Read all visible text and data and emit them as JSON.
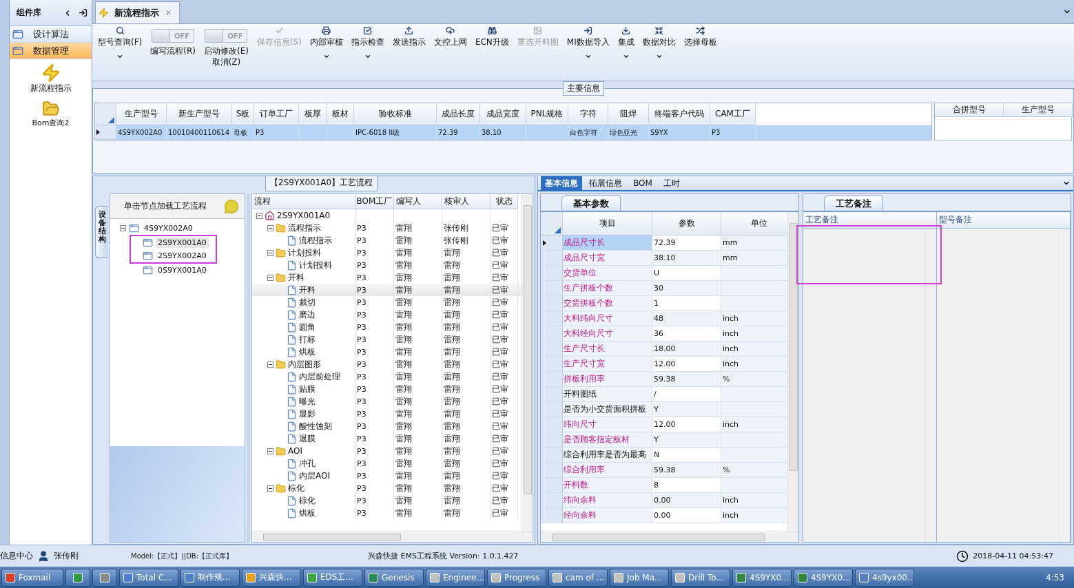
{
  "sidebar": {
    "title": "组件库",
    "items": [
      {
        "label": "设计算法",
        "selected": false
      },
      {
        "label": "数据管理",
        "selected": true
      }
    ],
    "shortcuts": [
      {
        "kind": "bolt",
        "label": "新流程指示"
      },
      {
        "kind": "folder",
        "label": "Bom查询2"
      }
    ]
  },
  "document_tab": {
    "label": "新流程指示",
    "selected": true
  },
  "toolbar": [
    {
      "kind": "button",
      "label": "型号查询(F)",
      "dropdown": true,
      "disabled": false
    },
    {
      "kind": "toggle",
      "switch_text": "OFF",
      "on": false,
      "label": "编写流程(R)"
    },
    {
      "kind": "toggle",
      "switch_text": "OFF",
      "on": false,
      "label": "启动修改(E)\n取消(Z)"
    },
    {
      "kind": "button",
      "label": "保存信息(S)",
      "dropdown": false,
      "disabled": true
    },
    {
      "kind": "button",
      "label": "内部审核",
      "dropdown": true,
      "disabled": false
    },
    {
      "kind": "button",
      "label": "指示检查",
      "dropdown": true,
      "disabled": false
    },
    {
      "kind": "button",
      "label": "发送指示",
      "dropdown": false,
      "disabled": false
    },
    {
      "kind": "button",
      "label": "文控上网",
      "dropdown": false,
      "disabled": false
    },
    {
      "kind": "button",
      "label": "ECN升级",
      "dropdown": false,
      "disabled": false
    },
    {
      "kind": "button",
      "label": "重选开料图",
      "dropdown": false,
      "disabled": true
    },
    {
      "kind": "button",
      "label": "MI数据导入",
      "dropdown": true,
      "disabled": false
    },
    {
      "kind": "button",
      "label": "集成",
      "dropdown": true,
      "disabled": false
    },
    {
      "kind": "button",
      "label": "数据对比",
      "dropdown": true,
      "disabled": false
    },
    {
      "kind": "button",
      "label": "选择母板",
      "dropdown": false,
      "disabled": false
    }
  ],
  "main_info": {
    "title": "主要信息",
    "columns": [
      "生产型号",
      "新生产型号",
      "S板",
      "订单工厂",
      "板厚",
      "板材",
      "验收标准",
      "成品长度",
      "成品宽度",
      "PNL规格",
      "字符",
      "阻焊",
      "终端客户代码",
      "CAM工厂"
    ],
    "rows": [
      {
        "selected": true,
        "cells": [
          "4S9YX002A0",
          "10010400110614",
          "母板",
          "P3",
          null,
          null,
          "IPC-6018 II级",
          "72.39",
          "38.10",
          null,
          "白色字符",
          "绿色亚光",
          "S9YX",
          "P3"
        ]
      }
    ],
    "merge_columns": [
      "合拼型号",
      "生产型号"
    ]
  },
  "flow": {
    "title": "【2S9YX001A0】工艺流程",
    "side_tab": "设备结构",
    "tree_hint": "单击节点加载工艺流程",
    "models": [
      {
        "label": "4S9YX002A0",
        "expanded": true,
        "selected": false,
        "children": [
          {
            "label": "2S9YX001A0",
            "selected": true
          },
          {
            "label": "2S9YX002A0",
            "selected": false
          },
          {
            "label": "0S9YX001A0",
            "selected": false
          }
        ]
      }
    ],
    "columns": [
      "流程",
      "BOM工厂",
      "编写人",
      "核审人",
      "状态"
    ],
    "root": {
      "kind": "root",
      "label": "2S9YX001A0",
      "expanded": true,
      "selected": false,
      "children": [
        {
          "kind": "folder",
          "label": "流程指示",
          "bom": "P3",
          "writer": "雷翔",
          "reviewer": "张传刚",
          "status": "已审",
          "expanded": true,
          "selected": false,
          "children": [
            {
              "kind": "step",
              "label": "流程指示",
              "bom": "P3",
              "writer": "雷翔",
              "reviewer": "张传刚",
              "status": "已审",
              "selected": false
            }
          ]
        },
        {
          "kind": "folder",
          "label": "计划投料",
          "bom": "P3",
          "writer": "雷翔",
          "reviewer": "雷翔",
          "status": "已审",
          "expanded": true,
          "selected": false,
          "children": [
            {
              "kind": "step",
              "label": "计划投料",
              "bom": "P3",
              "writer": "雷翔",
              "reviewer": "雷翔",
              "status": "已审",
              "selected": false
            }
          ]
        },
        {
          "kind": "folder",
          "label": "开料",
          "bom": "P3",
          "writer": "雷翔",
          "reviewer": "雷翔",
          "status": "已审",
          "expanded": true,
          "selected": false,
          "children": [
            {
              "kind": "step",
              "label": "开料",
              "bom": "P3",
              "writer": "雷翔",
              "reviewer": "雷翔",
              "status": "已审",
              "selected": true
            },
            {
              "kind": "step",
              "label": "裁切",
              "bom": "P3",
              "writer": "雷翔",
              "reviewer": "雷翔",
              "status": "已审",
              "selected": false
            },
            {
              "kind": "step",
              "label": "磨边",
              "bom": "P3",
              "writer": "雷翔",
              "reviewer": "雷翔",
              "status": "已审",
              "selected": false
            },
            {
              "kind": "step",
              "label": "圆角",
              "bom": "P3",
              "writer": "雷翔",
              "reviewer": "雷翔",
              "status": "已审",
              "selected": false
            },
            {
              "kind": "step",
              "label": "打标",
              "bom": "P3",
              "writer": "雷翔",
              "reviewer": "雷翔",
              "status": "已审",
              "selected": false
            },
            {
              "kind": "step",
              "label": "烘板",
              "bom": "P3",
              "writer": "雷翔",
              "reviewer": "雷翔",
              "status": "已审",
              "selected": false
            }
          ]
        },
        {
          "kind": "folder",
          "label": "内层图形",
          "bom": "P3",
          "writer": "雷翔",
          "reviewer": "雷翔",
          "status": "已审",
          "expanded": true,
          "selected": false,
          "children": [
            {
              "kind": "step",
              "label": "内层前处理",
              "bom": "P3",
              "writer": "雷翔",
              "reviewer": "雷翔",
              "status": "已审",
              "selected": false
            },
            {
              "kind": "step",
              "label": "贴膜",
              "bom": "P3",
              "writer": "雷翔",
              "reviewer": "雷翔",
              "status": "已审",
              "selected": false
            },
            {
              "kind": "step",
              "label": "曝光",
              "bom": "P3",
              "writer": "雷翔",
              "reviewer": "雷翔",
              "status": "已审",
              "selected": false
            },
            {
              "kind": "step",
              "label": "显影",
              "bom": "P3",
              "writer": "雷翔",
              "reviewer": "雷翔",
              "status": "已审",
              "selected": false
            },
            {
              "kind": "step",
              "label": "酸性蚀刻",
              "bom": "P3",
              "writer": "雷翔",
              "reviewer": "雷翔",
              "status": "已审",
              "selected": false
            },
            {
              "kind": "step",
              "label": "退膜",
              "bom": "P3",
              "writer": "雷翔",
              "reviewer": "雷翔",
              "status": "已审",
              "selected": false
            }
          ]
        },
        {
          "kind": "folder",
          "label": "AOI",
          "bom": "P3",
          "writer": "雷翔",
          "reviewer": "雷翔",
          "status": "已审",
          "expanded": true,
          "selected": false,
          "children": [
            {
              "kind": "step",
              "label": "冲孔",
              "bom": "P3",
              "writer": "雷翔",
              "reviewer": "雷翔",
              "status": "已审",
              "selected": false
            },
            {
              "kind": "step",
              "label": "内层AOI",
              "bom": "P3",
              "writer": "雷翔",
              "reviewer": "雷翔",
              "status": "已审",
              "selected": false
            }
          ]
        },
        {
          "kind": "folder",
          "label": "棕化",
          "bom": "P3",
          "writer": "雷翔",
          "reviewer": "雷翔",
          "status": "已审",
          "expanded": true,
          "selected": false,
          "children": [
            {
              "kind": "step",
              "label": "棕化",
              "bom": "P3",
              "writer": "雷翔",
              "reviewer": "雷翔",
              "status": "已审",
              "selected": false
            },
            {
              "kind": "step",
              "label": "烘板",
              "bom": "P3",
              "writer": "雷翔",
              "reviewer": "雷翔",
              "status": "已审",
              "selected": false
            }
          ]
        }
      ]
    }
  },
  "details": {
    "tabs": [
      {
        "label": "基本信息",
        "selected": true
      },
      {
        "label": "拓展信息",
        "selected": false
      },
      {
        "label": "BOM",
        "selected": false
      },
      {
        "label": "工时",
        "selected": false
      }
    ],
    "params": {
      "tab": "基本参数",
      "columns": [
        "项目",
        "参数",
        "单位"
      ],
      "rows": [
        {
          "item": "成品尺寸长",
          "value": "72.39",
          "unit": "mm",
          "required": true,
          "selected": true
        },
        {
          "item": "成品尺寸宽",
          "value": "38.10",
          "unit": "mm",
          "required": true,
          "selected": false
        },
        {
          "item": "交货单位",
          "value": "U",
          "required": true,
          "selected": false
        },
        {
          "item": "生产拼板个数",
          "value": "30",
          "required": true,
          "selected": false
        },
        {
          "item": "交货拼板个数",
          "value": "1",
          "required": true,
          "selected": false
        },
        {
          "item": "大料纬向尺寸",
          "value": "48",
          "unit": "inch",
          "required": true,
          "selected": false
        },
        {
          "item": "大料经向尺寸",
          "value": "36",
          "unit": "inch",
          "required": true,
          "selected": false
        },
        {
          "item": "生产尺寸长",
          "value": "18.00",
          "unit": "inch",
          "required": true,
          "selected": false
        },
        {
          "item": "生产尺寸宽",
          "value": "12.00",
          "unit": "inch",
          "required": true,
          "selected": false
        },
        {
          "item": "拼板利用率",
          "value": "59.38",
          "unit": "%",
          "required": true,
          "selected": false
        },
        {
          "item": "开料图纸",
          "value": "/",
          "required": false,
          "selected": false
        },
        {
          "item": "是否为小交货面积拼板",
          "value": "Y",
          "required": false,
          "selected": false
        },
        {
          "item": "纬向尺寸",
          "value": "12.00",
          "unit": "inch",
          "required": true,
          "selected": false
        },
        {
          "item": "是否顾客指定板材",
          "value": "Y",
          "required": true,
          "selected": false
        },
        {
          "item": "综合利用率是否为最高",
          "value": "N",
          "required": false,
          "selected": false
        },
        {
          "item": "综合利用率",
          "value": "59.38",
          "unit": "%",
          "required": true,
          "selected": false
        },
        {
          "item": "开料数",
          "value": "8",
          "required": true,
          "selected": false
        },
        {
          "item": "纬向余料",
          "value": "0.00",
          "unit": "inch",
          "required": true,
          "selected": false
        },
        {
          "item": "经向余料",
          "value": "0.00",
          "unit": "inch",
          "required": true,
          "selected": false
        }
      ]
    },
    "notes": {
      "tab": "工艺备注",
      "columns": [
        "工艺备注",
        "型号备注"
      ]
    }
  },
  "status_bar": {
    "info": "信息中心",
    "user": "张传刚",
    "model": "Model:【正式】||DB:【正式库】",
    "app": "兴森快捷 EMS工程系统 Version: 1.0.1.427",
    "datetime": "2018-04-11 04:53:47"
  },
  "taskbar": {
    "items": [
      {
        "kind": "app",
        "label": "Foxmail"
      },
      {
        "kind": "icon"
      },
      {
        "kind": "icon"
      },
      {
        "kind": "app",
        "label": "Total C..."
      },
      {
        "kind": "app",
        "label": "制作规..."
      },
      {
        "kind": "app",
        "label": "兴森快..."
      },
      {
        "kind": "app",
        "label": "EDS工..."
      },
      {
        "kind": "app",
        "label": "Genesis"
      },
      {
        "kind": "app",
        "label": "Enginee..."
      },
      {
        "kind": "app",
        "label": "Progress"
      },
      {
        "kind": "app",
        "label": "cam of ..."
      },
      {
        "kind": "app",
        "label": "Job Ma..."
      },
      {
        "kind": "app",
        "label": "Drill To..."
      },
      {
        "kind": "app",
        "label": "4S9YX0..."
      },
      {
        "kind": "app",
        "label": "4S9YX0..."
      },
      {
        "kind": "app",
        "label": "4s9yx00..."
      }
    ],
    "clock": "4:53"
  }
}
